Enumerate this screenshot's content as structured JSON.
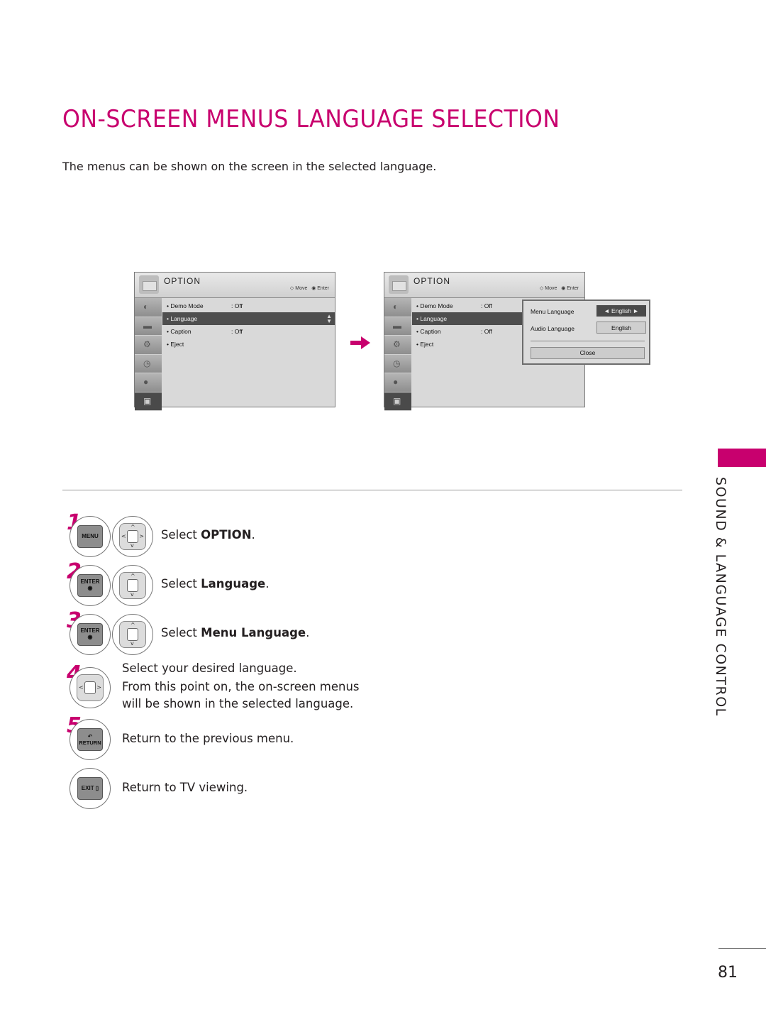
{
  "page": {
    "title": "ON-SCREEN MENUS LANGUAGE SELECTION",
    "intro": "The menus can be shown on the screen in the selected language.",
    "section_label": "SOUND & LANGUAGE CONTROL",
    "page_number": "81",
    "accent_color": "#c8006e"
  },
  "menu_screens": [
    {
      "title": "OPTION",
      "hint_move": "Move",
      "hint_enter": "Enter",
      "sidebar_icons": [
        "picture-icon",
        "tv-icon",
        "gear-icon",
        "clock-icon",
        "lock-icon",
        "option-icon"
      ],
      "items": [
        {
          "label": "• Demo Mode",
          "value": ": Off",
          "selected": false
        },
        {
          "label": "• Language",
          "value": "",
          "selected": true
        },
        {
          "label": "• Caption",
          "value": ": Off",
          "selected": false
        },
        {
          "label": "• Eject",
          "value": "",
          "selected": false
        }
      ]
    },
    {
      "title": "OPTION",
      "hint_move": "Move",
      "hint_enter": "Enter",
      "sidebar_icons": [
        "picture-icon",
        "tv-icon",
        "gear-icon",
        "clock-icon",
        "lock-icon",
        "option-icon"
      ],
      "items": [
        {
          "label": "• Demo Mode",
          "value": ": Off",
          "selected": false
        },
        {
          "label": "• Language",
          "value": "",
          "selected": true
        },
        {
          "label": "• Caption",
          "value": ": Off",
          "selected": false
        },
        {
          "label": "• Eject",
          "value": "",
          "selected": false
        }
      ],
      "popup": {
        "menu_language_label": "Menu Language",
        "menu_language_value": "◄ English ►",
        "audio_language_label": "Audio Language",
        "audio_language_value": "English",
        "close_label": "Close"
      }
    }
  ],
  "steps": [
    {
      "num": "1",
      "buttons": [
        "MENU",
        "nav-pad"
      ],
      "text_pre": "Select ",
      "text_bold": "OPTION",
      "text_post": "."
    },
    {
      "num": "2",
      "buttons": [
        "ENTER",
        "nav-pad-updown"
      ],
      "text_pre": "Select ",
      "text_bold": "Language",
      "text_post": "."
    },
    {
      "num": "3",
      "buttons": [
        "ENTER",
        "nav-pad-updown"
      ],
      "text_pre": "Select ",
      "text_bold": "Menu Language",
      "text_post": "."
    },
    {
      "num": "4",
      "buttons": [
        "nav-pad-leftright"
      ],
      "lines": [
        "Select your desired language.",
        "From this point on, the on-screen menus",
        "will be shown in the selected language."
      ]
    },
    {
      "num": "5",
      "buttons": [
        "RETURN"
      ],
      "text": "Return to the previous menu."
    },
    {
      "num": "",
      "buttons": [
        "EXIT"
      ],
      "text": "Return to TV viewing."
    }
  ],
  "button_labels": {
    "menu": "MENU",
    "enter": "ENTER",
    "return": "RETURN",
    "exit": "EXIT"
  }
}
